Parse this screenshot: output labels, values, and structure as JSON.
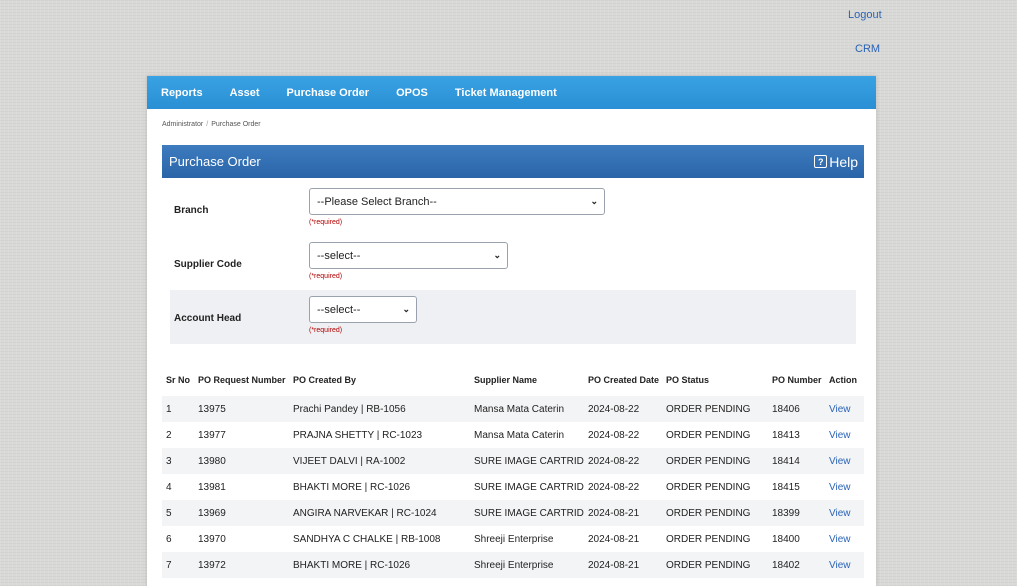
{
  "top_links": {
    "logout": "Logout",
    "crm": "CRM"
  },
  "nav": [
    "Reports",
    "Asset",
    "Purchase Order",
    "OPOS",
    "Ticket Management"
  ],
  "breadcrumb": {
    "root": "Administrator",
    "separator": "/",
    "current": "Purchase Order"
  },
  "panel": {
    "title": "Purchase Order",
    "help": "Help",
    "help_icon": "external-help-icon"
  },
  "form": {
    "branch": {
      "label": "Branch",
      "value": "--Please Select Branch--",
      "required": "(*required)"
    },
    "supplier_code": {
      "label": "Supplier Code",
      "value": "--select--",
      "required": "(*required)"
    },
    "account_head": {
      "label": "Account Head",
      "value": "--select--",
      "required": "(*required)"
    }
  },
  "table": {
    "headers": [
      "Sr No",
      "PO Request Number",
      "PO Created By",
      "Supplier Name",
      "PO Created Date",
      "PO Status",
      "PO Number",
      "Action"
    ],
    "rows": [
      [
        "1",
        "13975",
        "Prachi Pandey | RB-1056",
        "Mansa Mata Caterin",
        "2024-08-22",
        "ORDER PENDING",
        "18406",
        "View"
      ],
      [
        "2",
        "13977",
        "PRAJNA SHETTY | RC-1023",
        "Mansa Mata Caterin",
        "2024-08-22",
        "ORDER PENDING",
        "18413",
        "View"
      ],
      [
        "3",
        "13980",
        "VIJEET DALVI | RA-1002",
        "SURE IMAGE CARTRID",
        "2024-08-22",
        "ORDER PENDING",
        "18414",
        "View"
      ],
      [
        "4",
        "13981",
        "BHAKTI MORE | RC-1026",
        "SURE IMAGE CARTRID",
        "2024-08-22",
        "ORDER PENDING",
        "18415",
        "View"
      ],
      [
        "5",
        "13969",
        "ANGIRA NARVEKAR | RC-1024",
        "SURE IMAGE CARTRID",
        "2024-08-21",
        "ORDER PENDING",
        "18399",
        "View"
      ],
      [
        "6",
        "13970",
        "SANDHYA C CHALKE | RB-1008",
        "Shreeji Enterprise",
        "2024-08-21",
        "ORDER PENDING",
        "18400",
        "View"
      ],
      [
        "7",
        "13972",
        "BHAKTI MORE | RC-1026",
        "Shreeji Enterprise",
        "2024-08-21",
        "ORDER PENDING",
        "18402",
        "View"
      ]
    ]
  },
  "colors": {
    "nav_bg": "#2a8fd4",
    "panel_header_bg": "#2a64a8",
    "link": "#2a63b6",
    "required": "#b30000"
  }
}
